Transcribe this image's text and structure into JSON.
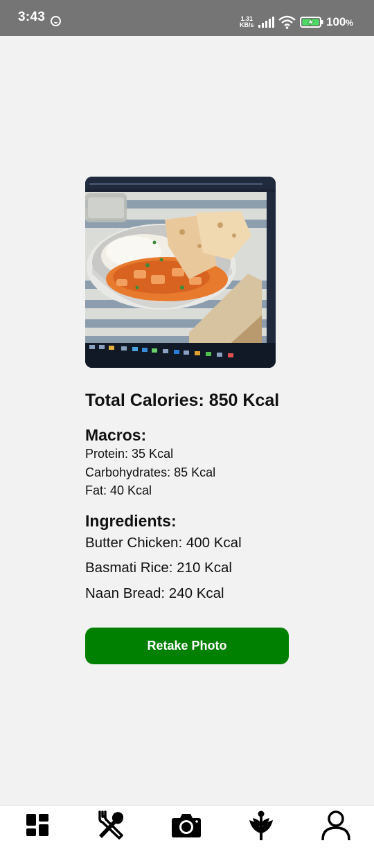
{
  "status_bar": {
    "time": "3:43",
    "net_rate_value": "1.31",
    "net_rate_unit": "KB/s",
    "battery_percent": "100",
    "battery_unit": "%",
    "icons": [
      "sync-icon",
      "signal-icon",
      "wifi-icon",
      "battery-charging-icon"
    ]
  },
  "photo": {
    "description_icon": "food-photo-image"
  },
  "results": {
    "total_calories": "Total Calories: 850 Kcal",
    "macros_title": "Macros:",
    "macros": [
      "Protein: 35 Kcal",
      "Carbohydrates: 85 Kcal",
      "Fat: 40 Kcal"
    ],
    "ingredients_title": "Ingredients:",
    "ingredients": [
      "Butter Chicken: 400 Kcal",
      "Basmati Rice: 210 Kcal",
      "Naan Bread: 240 Kcal"
    ]
  },
  "actions": {
    "retake_label": "Retake Photo",
    "accent_color": "#008000"
  },
  "bottom_nav": {
    "items": [
      {
        "icon": "dashboard-icon"
      },
      {
        "icon": "utensils-icon"
      },
      {
        "icon": "camera-icon"
      },
      {
        "icon": "plant-icon"
      },
      {
        "icon": "profile-icon"
      }
    ]
  }
}
